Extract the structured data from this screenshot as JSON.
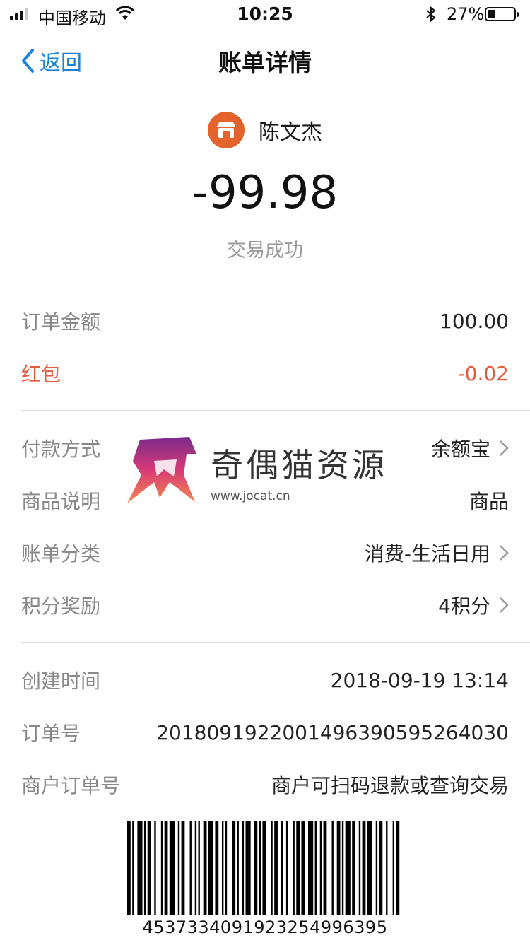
{
  "status_bar": {
    "carrier": "中国移动",
    "time": "10:25",
    "battery": "27%"
  },
  "nav": {
    "back_label": "返回",
    "title": "账单详情"
  },
  "header": {
    "merchant_name": "陈文杰",
    "amount": "-99.98",
    "status": "交易成功"
  },
  "section1": [
    {
      "label": "订单金额",
      "value": "100.00"
    },
    {
      "label": "红包",
      "value": "-0.02"
    }
  ],
  "section2": [
    {
      "label": "付款方式",
      "value": "余额宝"
    },
    {
      "label": "商品说明",
      "value": "商品"
    },
    {
      "label": "账单分类",
      "value": "消费-生活日用"
    },
    {
      "label": "积分奖励",
      "value": "4积分"
    }
  ],
  "section3": [
    {
      "label": "创建时间",
      "value": "2018-09-19 13:14"
    },
    {
      "label": "订单号",
      "value": "2018091922001496390595264030"
    },
    {
      "label": "商户订单号",
      "value": "商户可扫码退款或查询交易"
    }
  ],
  "watermark": {
    "title": "奇偶猫资源",
    "url": "www.jocat.cn"
  },
  "barcode_number": "4537334091923254996395",
  "colors": {
    "accent_blue": "#1a82d7",
    "red": "#e75b3c",
    "merchant_icon": "#e3632d"
  }
}
